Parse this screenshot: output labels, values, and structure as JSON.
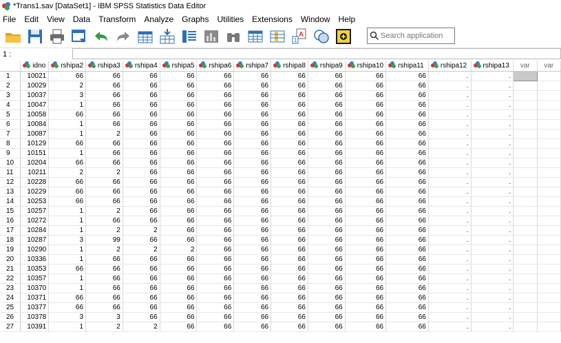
{
  "window": {
    "title": "*Trans1.sav [DataSet1] - IBM SPSS Statistics Data Editor"
  },
  "menu": [
    "File",
    "Edit",
    "View",
    "Data",
    "Transform",
    "Analyze",
    "Graphs",
    "Utilities",
    "Extensions",
    "Window",
    "Help"
  ],
  "toolbar": {
    "icons": [
      "open-folder-icon",
      "save-icon",
      "print-icon",
      "dialog-recall-icon",
      "undo-icon",
      "redo-icon",
      "goto-case-icon",
      "goto-variable-icon",
      "variables-icon",
      "run-descriptives-icon",
      "find-icon",
      "insert-cases-icon",
      "insert-variable-icon",
      "split-file-icon",
      "weight-cases-icon",
      "select-cases-icon",
      "value-labels-icon",
      "use-sets-icon"
    ],
    "search_placeholder": "Search application"
  },
  "cellbar": {
    "ref": "1 :",
    "value": ""
  },
  "grid": {
    "columns": [
      "idno",
      "rshipa2",
      "rshipa3",
      "rshipa4",
      "rshipa5",
      "rshipa6",
      "rshipa7",
      "rshipa8",
      "rshipa9",
      "rshipa10",
      "rshipa11",
      "rshipa12",
      "rshipa13",
      "var",
      "var"
    ],
    "rows": [
      [
        "10021",
        "66",
        "66",
        "66",
        "66",
        "66",
        "66",
        "66",
        "66",
        "66",
        "66",
        ".",
        "."
      ],
      [
        "10029",
        "2",
        "66",
        "66",
        "66",
        "66",
        "66",
        "66",
        "66",
        "66",
        "66",
        ".",
        "."
      ],
      [
        "10037",
        "3",
        "66",
        "66",
        "66",
        "66",
        "66",
        "66",
        "66",
        "66",
        "66",
        ".",
        "."
      ],
      [
        "10047",
        "1",
        "66",
        "66",
        "66",
        "66",
        "66",
        "66",
        "66",
        "66",
        "66",
        ".",
        "."
      ],
      [
        "10058",
        "66",
        "66",
        "66",
        "66",
        "66",
        "66",
        "66",
        "66",
        "66",
        "66",
        ".",
        "."
      ],
      [
        "10084",
        "1",
        "66",
        "66",
        "66",
        "66",
        "66",
        "66",
        "66",
        "66",
        "66",
        ".",
        "."
      ],
      [
        "10087",
        "1",
        "2",
        "66",
        "66",
        "66",
        "66",
        "66",
        "66",
        "66",
        "66",
        ".",
        "."
      ],
      [
        "10129",
        "66",
        "66",
        "66",
        "66",
        "66",
        "66",
        "66",
        "66",
        "66",
        "66",
        ".",
        "."
      ],
      [
        "10151",
        "1",
        "66",
        "66",
        "66",
        "66",
        "66",
        "66",
        "66",
        "66",
        "66",
        ".",
        "."
      ],
      [
        "10204",
        "66",
        "66",
        "66",
        "66",
        "66",
        "66",
        "66",
        "66",
        "66",
        "66",
        ".",
        "."
      ],
      [
        "10211",
        "2",
        "2",
        "66",
        "66",
        "66",
        "66",
        "66",
        "66",
        "66",
        "66",
        ".",
        "."
      ],
      [
        "10228",
        "66",
        "66",
        "66",
        "66",
        "66",
        "66",
        "66",
        "66",
        "66",
        "66",
        ".",
        "."
      ],
      [
        "10229",
        "66",
        "66",
        "66",
        "66",
        "66",
        "66",
        "66",
        "66",
        "66",
        "66",
        ".",
        "."
      ],
      [
        "10253",
        "66",
        "66",
        "66",
        "66",
        "66",
        "66",
        "66",
        "66",
        "66",
        "66",
        ".",
        "."
      ],
      [
        "10257",
        "1",
        "2",
        "66",
        "66",
        "66",
        "66",
        "66",
        "66",
        "66",
        "66",
        ".",
        "."
      ],
      [
        "10272",
        "1",
        "66",
        "66",
        "66",
        "66",
        "66",
        "66",
        "66",
        "66",
        "66",
        ".",
        "."
      ],
      [
        "10284",
        "1",
        "2",
        "2",
        "66",
        "66",
        "66",
        "66",
        "66",
        "66",
        "66",
        ".",
        "."
      ],
      [
        "10287",
        "3",
        "99",
        "66",
        "66",
        "66",
        "66",
        "66",
        "66",
        "66",
        "66",
        ".",
        "."
      ],
      [
        "10290",
        "1",
        "2",
        "2",
        "2",
        "66",
        "66",
        "66",
        "66",
        "66",
        "66",
        ".",
        "."
      ],
      [
        "10336",
        "1",
        "66",
        "66",
        "66",
        "66",
        "66",
        "66",
        "66",
        "66",
        "66",
        ".",
        "."
      ],
      [
        "10353",
        "66",
        "66",
        "66",
        "66",
        "66",
        "66",
        "66",
        "66",
        "66",
        "66",
        ".",
        "."
      ],
      [
        "10357",
        "1",
        "66",
        "66",
        "66",
        "66",
        "66",
        "66",
        "66",
        "66",
        "66",
        ".",
        "."
      ],
      [
        "10370",
        "1",
        "66",
        "66",
        "66",
        "66",
        "66",
        "66",
        "66",
        "66",
        "66",
        ".",
        "."
      ],
      [
        "10371",
        "66",
        "66",
        "66",
        "66",
        "66",
        "66",
        "66",
        "66",
        "66",
        "66",
        ".",
        "."
      ],
      [
        "10377",
        "66",
        "66",
        "66",
        "66",
        "66",
        "66",
        "66",
        "66",
        "66",
        "66",
        ".",
        "."
      ],
      [
        "10378",
        "3",
        "3",
        "66",
        "66",
        "66",
        "66",
        "66",
        "66",
        "66",
        "66",
        ".",
        "."
      ],
      [
        "10391",
        "1",
        "2",
        "2",
        "66",
        "66",
        "66",
        "66",
        "66",
        "66",
        "66",
        ".",
        "."
      ]
    ]
  }
}
